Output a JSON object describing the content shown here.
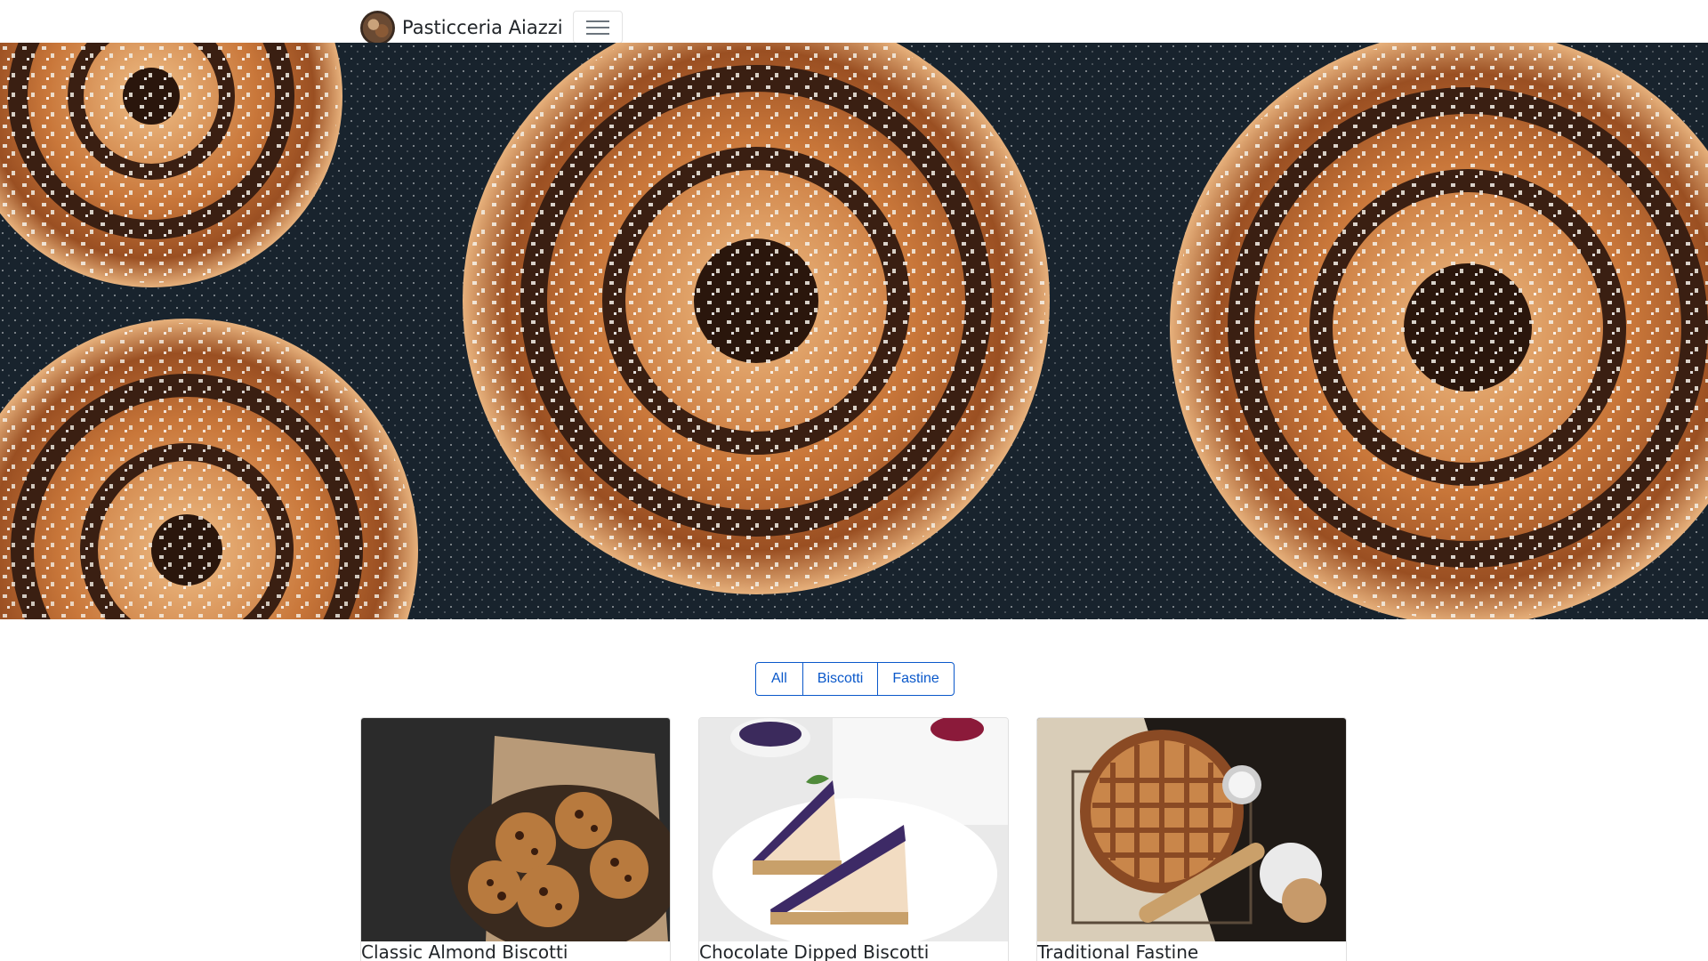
{
  "navbar": {
    "brand_name": "Pasticceria Aiazzi",
    "logo_icon": "pastry-logo-icon",
    "toggler_icon": "hamburger-menu-icon"
  },
  "hero": {
    "image": "cinnamon-buns-on-dark-surface-photo"
  },
  "filters": {
    "buttons": [
      {
        "label": "All"
      },
      {
        "label": "Biscotti"
      },
      {
        "label": "Fastine"
      }
    ],
    "accent_color": "#0a58ca"
  },
  "products": [
    {
      "title": "Classic Almond Biscotti",
      "image": "cookies-in-basket-photo"
    },
    {
      "title": "Chocolate Dipped Biscotti",
      "image": "blueberry-cheesecake-slices-photo"
    },
    {
      "title": "Traditional Fastine",
      "image": "lattice-pie-with-rolling-pin-photo"
    }
  ]
}
